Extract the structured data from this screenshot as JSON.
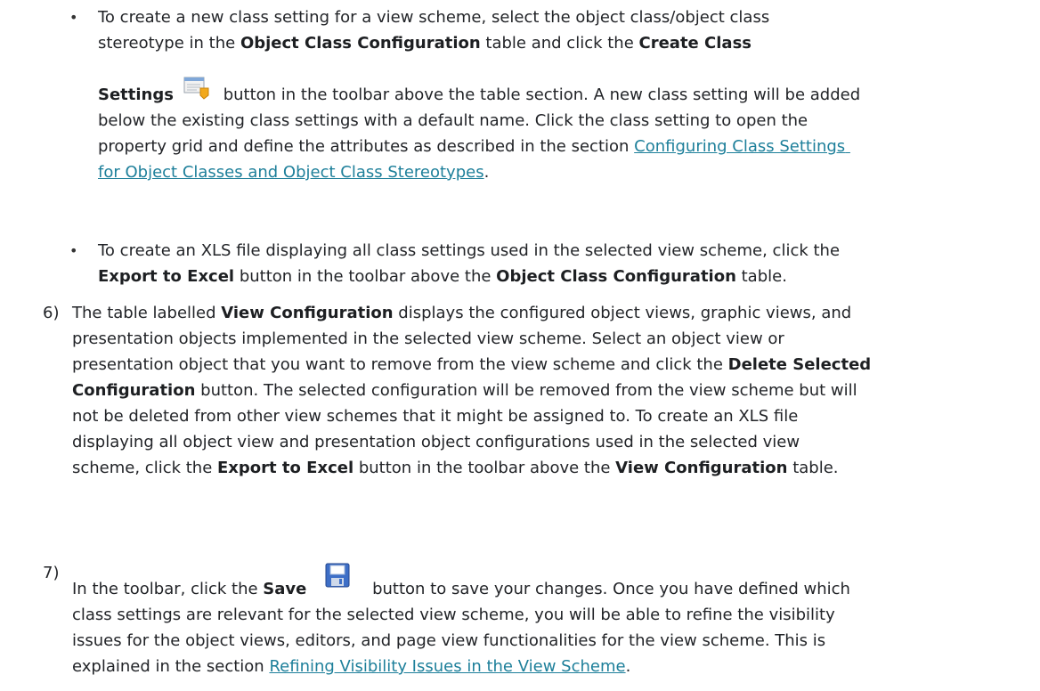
{
  "bullets": [
    {
      "marker": "•",
      "line1": "To create a new class setting for a view scheme, select the object class/object class",
      "line2_pre": "stereotype in the ",
      "line2_bold1": "Object Class Configuration",
      "line2_mid": " table and click the ",
      "line2_bold2": "Create Class",
      "line3_bold": "Settings",
      "line3_post": " button in the toolbar above the table section. A new class setting will be added",
      "line4": "below the existing class settings with a default name. Click the class setting to open the",
      "line5": "property grid and define the attributes as described in the section ",
      "link1_a": "Configuring Class Settings",
      "link1_b": "for Object Classes and Object Class Stereotypes",
      "line6_post": ".",
      "icon": "class-settings-icon"
    },
    {
      "marker": "•",
      "line1": "To create an XLS file displaying all class settings used in the selected view scheme, click the",
      "line2_bold1": "Export to Excel",
      "line2_mid": " button in the toolbar above the ",
      "line2_bold2": "Object Class Configuration",
      "line2_post": " table."
    }
  ],
  "step6": {
    "label": "6)",
    "l1_pre": "The table labelled ",
    "l1_bold": "View Configuration",
    "l1_post": " displays the configured object views, graphic views, and",
    "l2": "presentation objects implemented in the selected view scheme. Select an object view or",
    "l3_pre": "presentation object that you want to remove from the view scheme and click the ",
    "l3_bold": "Delete Selected",
    "l4_bold": "Configuration",
    "l4_post": " button. The selected configuration will be removed from the view scheme but will",
    "l5": "not be deleted from other view schemes that it might be assigned to. To create an XLS file",
    "l6": "displaying all object view and presentation object configurations used in the selected view",
    "l7_pre": "scheme, click the ",
    "l7_bold1": "Export to Excel",
    "l7_mid": " button in the toolbar above the ",
    "l7_bold2": "View Configuration",
    "l7_post": " table."
  },
  "step7": {
    "label": "7)",
    "l1_pre": "In the toolbar, click the ",
    "l1_bold": "Save",
    "l1_post": " button to save your changes. Once you have defined which",
    "l2": "class settings are relevant for the selected view scheme, you will be able to refine the visibility",
    "l3": "issues for the object views, editors, and page view functionalities for the view scheme. This is",
    "l4_pre": "explained in the section ",
    "link": "Refining Visibility Issues in the View Scheme",
    "l4_post": ".",
    "icon": "save-icon"
  },
  "colors": {
    "text": "#222428",
    "link": "#1d7f9a"
  }
}
